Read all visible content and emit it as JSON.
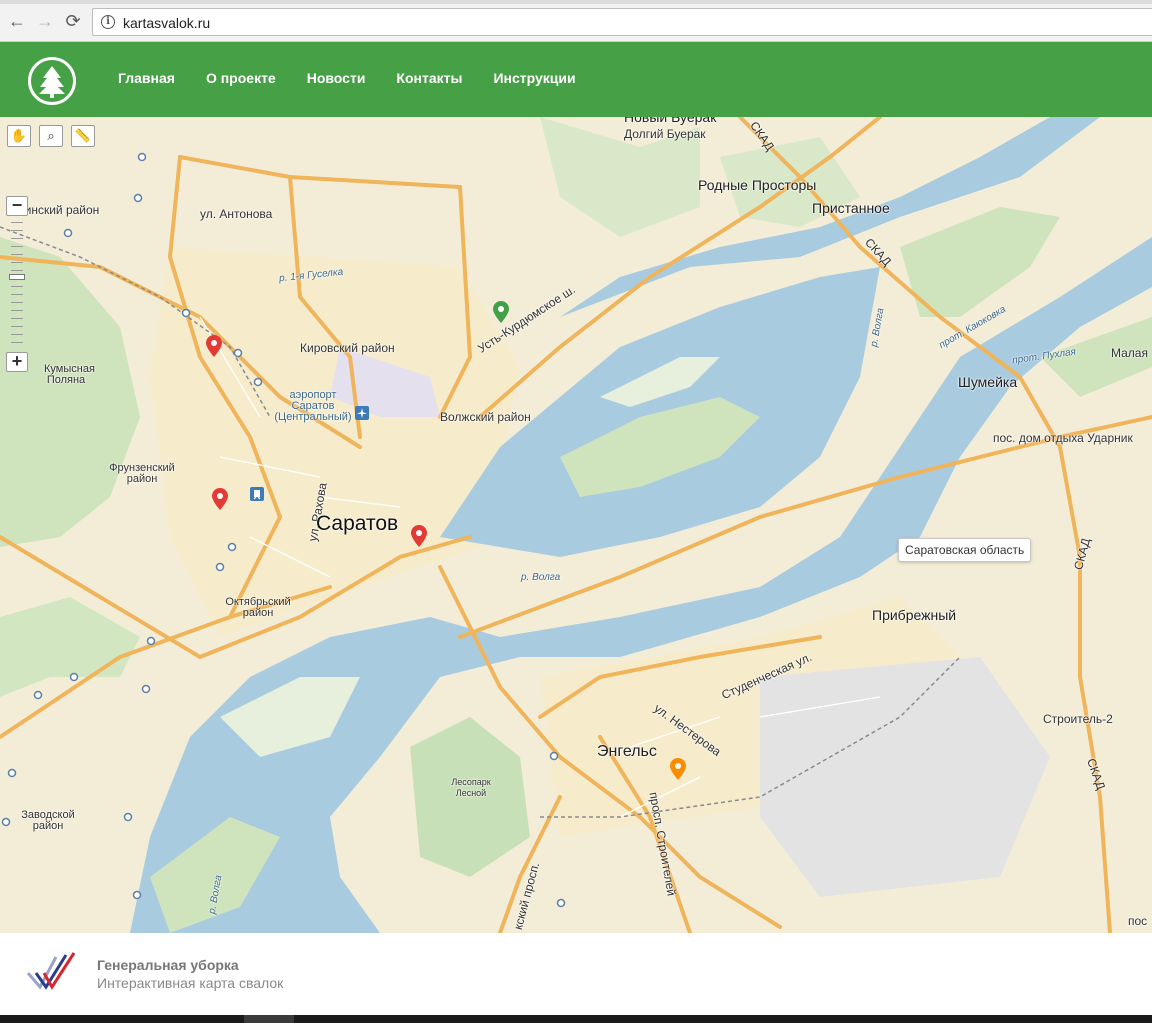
{
  "browser": {
    "url": "kartasvalok.ru",
    "back_icon": "←",
    "forward_icon": "→",
    "reload_icon": "⟳",
    "info_icon": "i"
  },
  "header": {
    "bg_color": "#45a046",
    "logo_icon": "tree-logo-icon",
    "menu": [
      {
        "label": "Главная"
      },
      {
        "label": "О проекте"
      },
      {
        "label": "Новости"
      },
      {
        "label": "Контакты"
      },
      {
        "label": "Инструкции"
      }
    ]
  },
  "map": {
    "tools": {
      "hand": "✋",
      "zoom": "⌕",
      "ruler": "📏"
    },
    "zoom_in": "+",
    "zoom_out": "−",
    "zoom_level": 0.55,
    "hint": "Саратовская область",
    "labels": {
      "novy_buerak": "Новый Буерак",
      "dolgiy_buerak": "Долгий Буерак",
      "skad1": "СКАД",
      "rodnye": "Родные Просторы",
      "pristannoe": "Пристанное",
      "skad2": "СКАД",
      "leninsky": "нинский район",
      "antonova": "ул. Антонова",
      "gyselka": "р. 1-я Гуселка",
      "ust_kurd": "Усть-Курдюмское ш.",
      "kirovsky": "Кировский район",
      "kumysnaya": "Кумысная Поляна",
      "airport": "аэропорт Саратов (Центральный)",
      "volzhsky": "Волжский район",
      "kayukovka": "прот. Каюковка",
      "puhlya": "прот. Пухлая",
      "malaya": "Малая",
      "shumeika": "Шумейка",
      "udarnik": "пос. дом отдыха Ударник",
      "volga1": "р. Волга",
      "frunzensky": "Фрунзенский район",
      "rakhova": "ул. Рахова",
      "saratov": "Саратов",
      "volga2": "р. Волга",
      "skad3": "СКАД",
      "oktyabrsky": "Октябрьский район",
      "pribrezhny": "Прибрежный",
      "studencheskaya": "Студенческая ул.",
      "nesterova": "ул. Нестерова",
      "stroitel2": "Строитель-2",
      "engels": "Энгельс",
      "lesopark": "Лесопарк Лесной",
      "skad4": "СКАД",
      "zavodskoy": "Заводской район",
      "stroiteley": "просп. Строителей",
      "volga3": "р. Волга",
      "kiy_prosp": "кский просп.",
      "pos": "пос"
    }
  },
  "footer": {
    "title": "Генеральная уборка",
    "subtitle": "Интерактивная карта свалок"
  }
}
